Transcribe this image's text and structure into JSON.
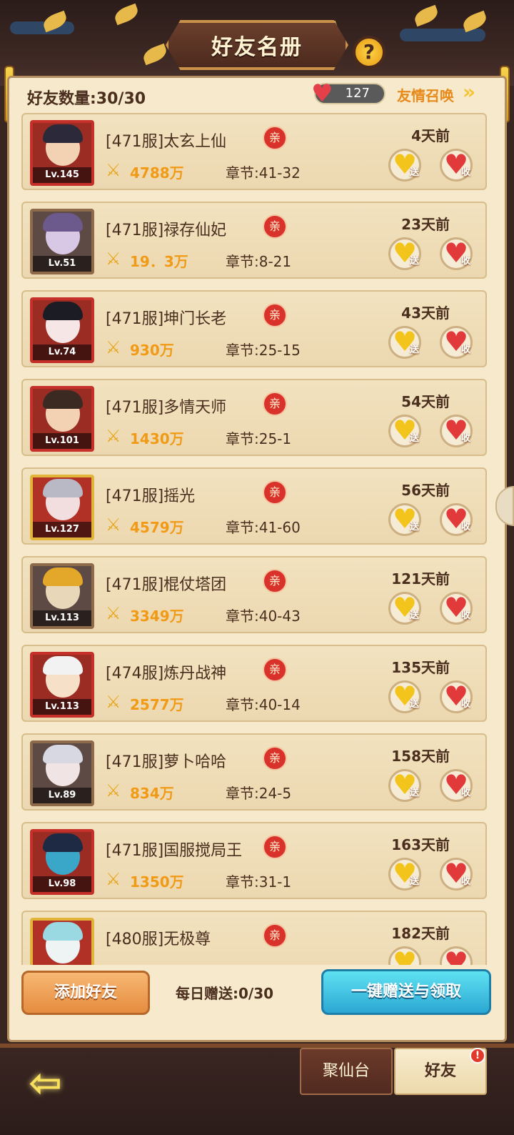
{
  "header": {
    "title": "好友名册",
    "help_label": "?"
  },
  "summary": {
    "friend_count": "好友数量:30/30",
    "hearts": "127",
    "summon_label": "友情召唤",
    "summon_arrow": "»"
  },
  "row_labels": {
    "kin": "亲",
    "give": "送",
    "recv": "收",
    "heart_glyph": "♥",
    "power_glyph": "⚔"
  },
  "friends": [
    {
      "name": "[471服]太玄上仙",
      "level": "Lv.145",
      "ago": "4天前",
      "power": "4788万",
      "chapter": "章节:41-32"
    },
    {
      "name": "[471服]禄存仙妃",
      "level": "Lv.51",
      "ago": "23天前",
      "power": "19．3万",
      "chapter": "章节:8-21"
    },
    {
      "name": "[471服]坤门长老",
      "level": "Lv.74",
      "ago": "43天前",
      "power": "930万",
      "chapter": "章节:25-15"
    },
    {
      "name": "[471服]多情天师",
      "level": "Lv.101",
      "ago": "54天前",
      "power": "1430万",
      "chapter": "章节:25-1"
    },
    {
      "name": "[471服]摇光",
      "level": "Lv.127",
      "ago": "56天前",
      "power": "4579万",
      "chapter": "章节:41-60"
    },
    {
      "name": "[471服]棍仗塔团",
      "level": "Lv.113",
      "ago": "121天前",
      "power": "3349万",
      "chapter": "章节:40-43"
    },
    {
      "name": "[474服]炼丹战神",
      "level": "Lv.113",
      "ago": "135天前",
      "power": "2577万",
      "chapter": "章节:40-14"
    },
    {
      "name": "[471服]萝卜哈哈",
      "level": "Lv.89",
      "ago": "158天前",
      "power": "834万",
      "chapter": "章节:24-5"
    },
    {
      "name": "[471服]国服搅局王",
      "level": "Lv.98",
      "ago": "163天前",
      "power": "1350万",
      "chapter": "章节:31-1"
    },
    {
      "name": "[480服]无极尊",
      "level": "",
      "ago": "182天前",
      "power": "",
      "chapter": ""
    }
  ],
  "footer": {
    "add_friend": "添加好友",
    "daily_give": "每日赠送:0/30",
    "one_click": "一键赠送与领取"
  },
  "nav": {
    "back_glyph": "⇦",
    "tab_jxt": "聚仙台",
    "tab_friend": "好友",
    "notice": "!"
  },
  "colors": {
    "gold": "#f09a16",
    "panel": "#f6e9cc",
    "heart_red": "#e23a3a",
    "heart_gold": "#f3c41c"
  }
}
